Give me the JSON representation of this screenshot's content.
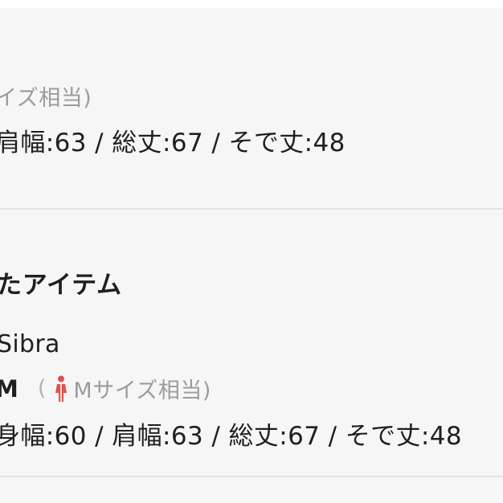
{
  "item_top": {
    "size_note": "イズ相当)",
    "measurements": "肩幅:63 / 総丈:67 / そで丈:48"
  },
  "related_section": {
    "title": "たアイテム",
    "item": {
      "brand": "Sibra",
      "size_value": "M",
      "open_paren": "(",
      "size_note": "Mサイズ相当)",
      "measurements": "身幅:60 / 肩幅:63 / 総丈:67 / そで丈:48"
    }
  },
  "colors": {
    "background": "#f6f6f6",
    "divider": "#e4e4e4",
    "muted_text": "#9c9c9c",
    "woman_icon": "#e0524f"
  },
  "icons": {
    "size_gender_icon": "woman-icon"
  }
}
